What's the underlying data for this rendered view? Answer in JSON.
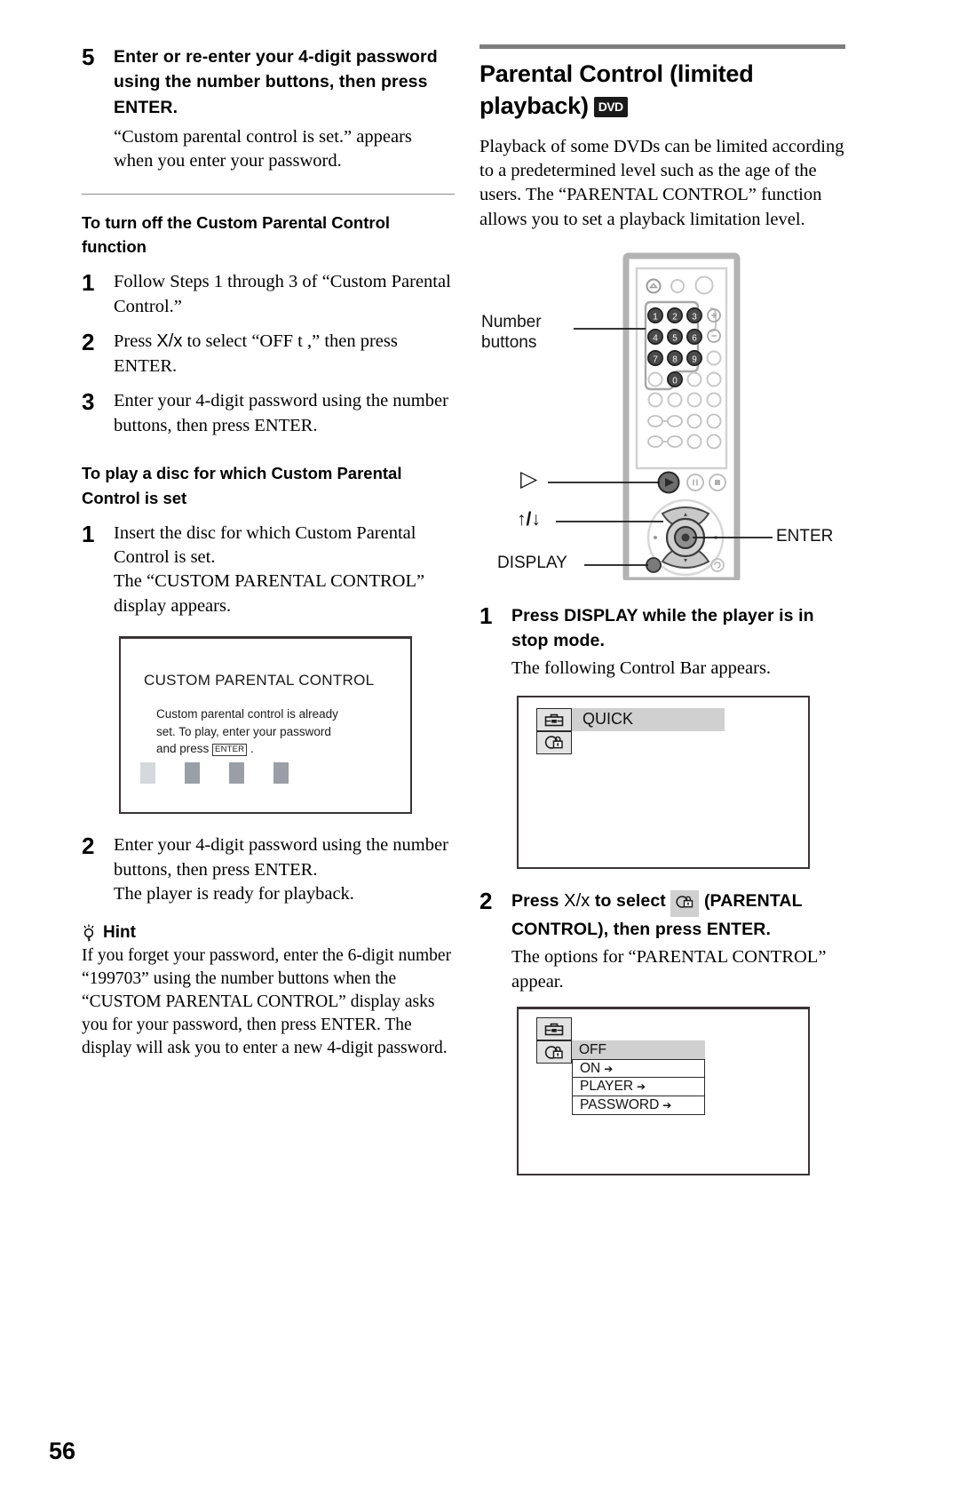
{
  "page_number": "56",
  "left_column": {
    "step5": {
      "num": "5",
      "head": "Enter or re-enter your 4-digit password using the number buttons, then press ENTER.",
      "desc": "“Custom parental control is set.” appears when you enter your password."
    },
    "section_turn_off": {
      "heading": "To turn off the Custom Parental Control function",
      "steps": [
        {
          "num": "1",
          "text": "Follow Steps 1 through 3 of “Custom Parental Control.”"
        },
        {
          "num": "2",
          "text_before": "Press ",
          "keys": "X/x",
          "text_after": " to select “OFF t    ,” then press ENTER."
        },
        {
          "num": "3",
          "text": "Enter your 4-digit password using the number buttons, then press ENTER."
        }
      ]
    },
    "section_play_disc": {
      "heading": "To play a disc for which Custom Parental Control is set",
      "step1": {
        "num": "1",
        "line1": "Insert the disc for which Custom Parental Control is set.",
        "line2": "The “CUSTOM PARENTAL CONTROL” display appears."
      },
      "screen": {
        "title": "CUSTOM PARENTAL CONTROL",
        "body_line1": "Custom parental control is already",
        "body_line2": "set. To play, enter your password",
        "body_line3_before": "and press ",
        "body_key": "ENTER",
        "body_line3_after": " .",
        "password_slots": 4
      },
      "step2": {
        "num": "2",
        "line1": "Enter your 4-digit password using the number buttons, then press ENTER.",
        "line2": "The player is ready for playback."
      }
    },
    "hint": {
      "label": "Hint",
      "text": "If you forget your password, enter the 6-digit number “199703” using the number buttons when the “CUSTOM PARENTAL CONTROL” display asks you for your password, then press ENTER. The display will ask you to enter a new 4-digit password."
    }
  },
  "right_column": {
    "section_title_line1": "Parental Control (limited",
    "section_title_line2": "playback)",
    "dvd_badge": "DVD",
    "intro": "Playback of some DVDs can be limited according to a predetermined level such as the age of the users. The “PARENTAL CONTROL” function allows you to set a playback limitation level.",
    "remote": {
      "callout_number_buttons_line1": "Number",
      "callout_number_buttons_line2": "buttons",
      "callout_play": "▷",
      "callout_arrows": "↑/↓",
      "callout_display": "DISPLAY",
      "callout_enter": "ENTER",
      "number_keys": [
        "1",
        "2",
        "3",
        "4",
        "5",
        "6",
        "7",
        "8",
        "9",
        "0"
      ]
    },
    "step1": {
      "num": "1",
      "head": "Press DISPLAY while the player is in stop mode.",
      "desc": "The following Control Bar appears."
    },
    "control_bar_screen": {
      "quick_label": "QUICK",
      "toolbox_icon": "toolbox-icon",
      "parental_icon": "parental-lock-icon"
    },
    "step2": {
      "num": "2",
      "head_before": "Press ",
      "keys": "X/x",
      "head_mid": " to select ",
      "head_after": " (PARENTAL CONTROL), then press ENTER.",
      "desc": "The options for “PARENTAL CONTROL” appear."
    },
    "options_screen": {
      "options": [
        {
          "label": "OFF",
          "arrow": "",
          "highlighted": true
        },
        {
          "label": "ON",
          "arrow": "➔",
          "highlighted": false
        },
        {
          "label": "PLAYER",
          "arrow": "➔",
          "highlighted": false
        },
        {
          "label": "PASSWORD",
          "arrow": "➔",
          "highlighted": false
        }
      ]
    }
  },
  "colors": {
    "rule": "#7d7d7d",
    "screen_border": "#3a3434",
    "highlight": "#d0d0d0",
    "pw_box": "#9a9ea6",
    "pw_box_first": "#d5d8dc"
  }
}
